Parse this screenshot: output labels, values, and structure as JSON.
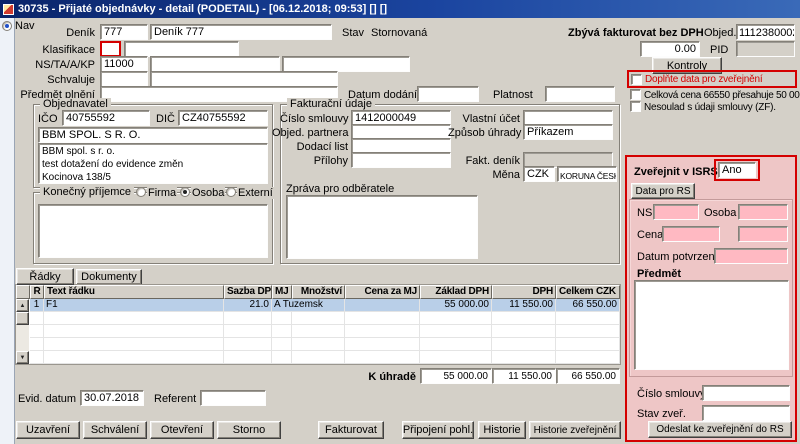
{
  "window": {
    "title": "30735 - Přijaté objednávky - detail (PODETAIL) - [06.12.2018; 09:53] [] []"
  },
  "nav": {
    "label": "Nav"
  },
  "top": {
    "denik_label": "Deník",
    "denik_code": "777",
    "denik_name": "Deník 777",
    "stav_label": "Stav",
    "stav_value": "Stornovaná",
    "klasifikace_label": "Klasifikace",
    "ns_label": "NS/TA/A/KP",
    "ns_value": "11000",
    "schvaluje_label": "Schvaluje",
    "predmet_plneni_label": "Předmět plnění",
    "datum_dodani_label": "Datum dodání",
    "platnost_label": "Platnost",
    "zbyva_label": "Zbývá fakturovat bez DPH",
    "zbyva_value": "0.00",
    "objed_label": "Objed.",
    "objed_value": "1112380002",
    "pid_label": "PID",
    "kontroly_button": "Kontroly",
    "check_doplnte": "Doplňte data pro zveřejnění",
    "check_celkova": "Celková cena 66550 přesahuje 50 00",
    "check_nesoulad": "Nesoulad s údaji smlouvy (ZF)."
  },
  "objednavatel": {
    "legend": "Objednavatel",
    "ico_label": "IČO",
    "ico_value": "40755592",
    "dic_label": "DIČ",
    "dic_value": "CZ40755592",
    "nazev": "BBM SPOL. S R. O.",
    "adresa": "BBM spol. s r. o.\ntest dotažení do evidence změn\nKocinova 138/5"
  },
  "fakturace": {
    "legend": "Fakturační údaje",
    "cislo_smlouvy_label": "Číslo smlouvy",
    "cislo_smlouvy_value": "1412000049",
    "vlastni_ucet_label": "Vlastní účet",
    "objed_partnera_label": "Objed. partnera",
    "zpusob_uhrady_label": "Způsob úhrady",
    "zpusob_uhrady_value": "Příkazem",
    "dodaci_list_label": "Dodací list",
    "prilohy_label": "Přílohy",
    "fakt_denik_label": "Fakt. deník",
    "zprava_label": "Zpráva pro odběratele",
    "mena_label": "Měna",
    "mena_code": "CZK",
    "mena_name": "KORUNA ČESKÁ"
  },
  "prijemce": {
    "legend": "Konečný příjemce",
    "option_firma": "Firma",
    "option_osoba": "Osoba",
    "option_externi": "Externí",
    "selected": "Osoba"
  },
  "isrs": {
    "zverejnit_label": "Zveřejnit v ISRS",
    "zverejnit_value": "Ano",
    "tab_label": "Data pro RS",
    "ns_label": "NS",
    "osoba_label": "Osoba",
    "cena_label": "Cena",
    "datum_potvrzeni_label": "Datum potvrzení",
    "predmet_label": "Předmět",
    "cislo_smlouvy_label": "Číslo smlouvy",
    "stav_zver_label": "Stav zveř.",
    "odeslat_button": "Odeslat ke zveřejnění do RS"
  },
  "tabs": {
    "radky": "Řádky",
    "dokumenty": "Dokumenty"
  },
  "table": {
    "columns": [
      "Ř",
      "Text řádku",
      "Sazba DPH",
      "MJ",
      "Množství",
      "Cena za MJ",
      "Základ DPH",
      "DPH",
      "Celkem CZK"
    ],
    "row1": {
      "r": "1",
      "text": "F1",
      "sazba": "21.0",
      "mj": "A Tuzemsk",
      "mnozstvi": "",
      "cena_za_mj": "",
      "zaklad": "55 000.00",
      "dph": "11 550.00",
      "celkem": "66 550.00"
    },
    "footer_label": "K úhradě",
    "footer_zaklad": "55 000.00",
    "footer_dph": "11 550.00",
    "footer_celkem": "66 550.00"
  },
  "bottom": {
    "evid_datum_label": "Evid. datum",
    "evid_datum_value": "30.07.2018",
    "referent_label": "Referent",
    "buttons": [
      "Uzavření",
      "Schválení",
      "Otevření",
      "Storno",
      "Fakturovat",
      "Připojení pohl.",
      "Historie",
      "Historie zveřejnění"
    ]
  },
  "colors": {
    "titlebar": "#0a246a",
    "alert_red": "#d40000",
    "panel_pink": "#eec6c6",
    "field_pink": "#ffb9c2",
    "selected_row": "#b9cfe8"
  }
}
